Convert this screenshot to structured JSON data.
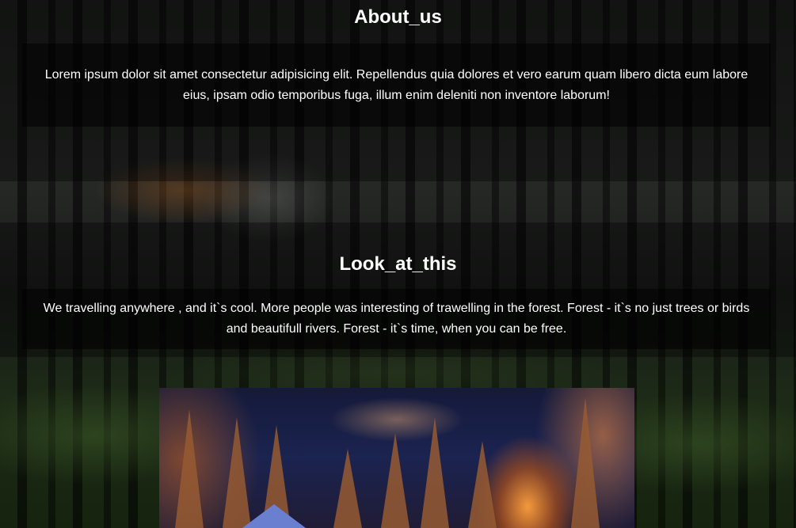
{
  "about": {
    "title": "About_us",
    "text": "Lorem ipsum dolor sit amet consectetur adipisicing elit. Repellendus quia dolores et vero earum quam libero dicta eum labore eius, ipsam odio temporibus fuga, illum enim deleniti non inventore laborum!"
  },
  "look": {
    "title": "Look_at_this",
    "text": "We travelling anywhere , and it`s cool. More people was interesting of trawelling in the forest. Forest - it`s no just trees or birds and beautifull rivers. Forest - it`s time, when you can be free."
  },
  "photo": {
    "subject": "campfire-in-snowy-forest"
  }
}
